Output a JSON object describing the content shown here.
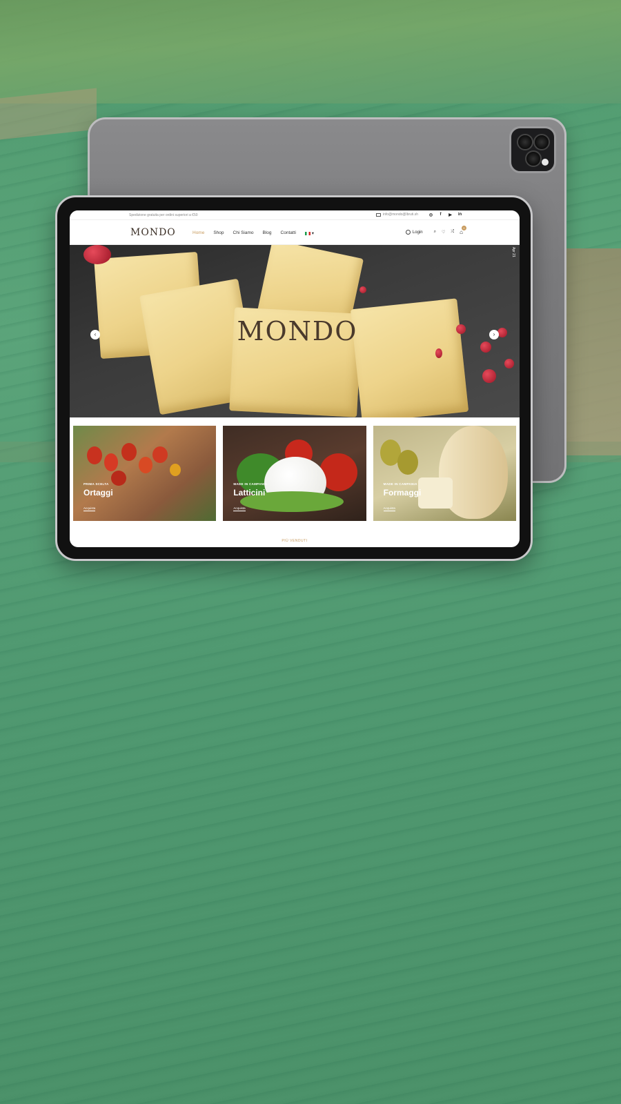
{
  "topbar": {
    "shipping_text": "Spedizione gratuita per ordini superiori a €50",
    "email": "info@mondo@lbruti.sh",
    "social": [
      "instagram-icon",
      "facebook-icon",
      "youtube-icon",
      "linkedin-icon"
    ]
  },
  "nav": {
    "logo": "MONDO",
    "items": [
      "Home",
      "Shop",
      "Chi Siamo",
      "Blog",
      "Contatti"
    ],
    "active_item": "Home",
    "login_label": "Login",
    "cart_count": "0"
  },
  "hero": {
    "logo_text": "MONDO",
    "side_date": "Apr 21"
  },
  "cards": [
    {
      "kicker": "PRIMA SCELTA",
      "title": "Ortaggi",
      "link": "Acquista"
    },
    {
      "kicker": "MADE IN CAMPANIA",
      "title": "Latticini",
      "link": "Acquista"
    },
    {
      "kicker": "MADE IN CAMPANIA",
      "title": "Formaggi",
      "link": "Acquista"
    }
  ],
  "bestseller_label": "PIÙ VENDUTI",
  "colors": {
    "accent": "#c89b5e",
    "field_green": "#5ba47a",
    "tablet_gray": "#7b7b7d"
  }
}
